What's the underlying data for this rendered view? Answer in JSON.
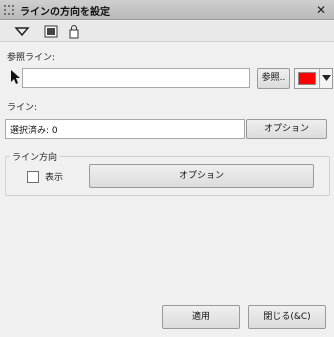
{
  "window": {
    "title": "ラインの方向を設定",
    "close_glyph": "✕"
  },
  "toolbar": {
    "icons": [
      "dropdown-arrow-icon",
      "image-icon",
      "lock-icon"
    ]
  },
  "reference_line": {
    "label": "参照ライン:",
    "value": "",
    "browse_label": "参照..",
    "color": "#ff0000"
  },
  "line": {
    "label": "ライン:",
    "value": "選択済み: 0",
    "options_label": "オプション"
  },
  "line_direction": {
    "group_label": "ライン方向",
    "show_label": "表示",
    "show_checked": false,
    "options_label": "オプション"
  },
  "footer": {
    "apply_label": "適用",
    "close_label": "閉じる(&C)"
  }
}
